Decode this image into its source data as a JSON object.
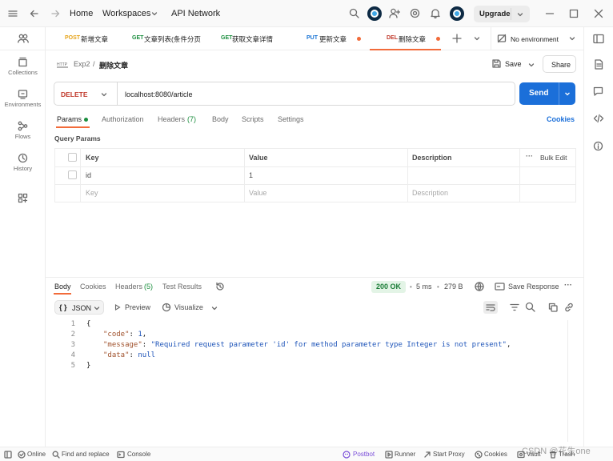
{
  "titlebar": {
    "home": "Home",
    "workspaces": "Workspaces",
    "api_network": "API Network",
    "upgrade": "Upgrade"
  },
  "tabs": [
    {
      "method": "POST",
      "name": "新增文章"
    },
    {
      "method": "GET",
      "name": "文章列表(条件分页"
    },
    {
      "method": "GET",
      "name": "获取文章详情"
    },
    {
      "method": "PUT",
      "name": "更新文章"
    },
    {
      "method": "DEL",
      "name": "删除文章"
    }
  ],
  "environment": "No environment",
  "sidebar": [
    {
      "label": "Collections"
    },
    {
      "label": "Environments"
    },
    {
      "label": "Flows"
    },
    {
      "label": "History"
    }
  ],
  "breadcrumb": {
    "parent": "Exp2",
    "separator": "/",
    "current": "删除文章"
  },
  "actions": {
    "save": "Save",
    "share": "Share"
  },
  "request": {
    "method": "DELETE",
    "url": "localhost:8080/article",
    "send": "Send"
  },
  "request_tabs": {
    "params": "Params",
    "authorization": "Authorization",
    "headers": "Headers",
    "headers_count": "(7)",
    "body": "Body",
    "scripts": "Scripts",
    "settings": "Settings",
    "cookies": "Cookies"
  },
  "query_params": {
    "title": "Query Params",
    "columns": [
      "Key",
      "Value",
      "Description"
    ],
    "bulk_edit": "Bulk Edit",
    "rows": [
      {
        "key": "id",
        "value": "1",
        "description": ""
      }
    ],
    "placeholder": {
      "key": "Key",
      "value": "Value",
      "description": "Description"
    }
  },
  "response_tabs": {
    "body": "Body",
    "cookies": "Cookies",
    "headers": "Headers",
    "headers_count": "(5)",
    "test_results": "Test Results"
  },
  "response_meta": {
    "status": "200 OK",
    "time": "5 ms",
    "size": "279 B",
    "save_response": "Save Response"
  },
  "response_view": {
    "format": "JSON",
    "preview": "Preview",
    "visualize": "Visualize"
  },
  "response_body": {
    "line_numbers": [
      "1",
      "2",
      "3",
      "4",
      "5"
    ],
    "open_brace": "{",
    "code_key": "\"code\"",
    "code_value": "1",
    "message_key": "\"message\"",
    "message_value": "\"Required request parameter 'id' for method parameter type Integer is not present\"",
    "data_key": "\"data\"",
    "data_value": "null",
    "close_brace": "}"
  },
  "statusbar": {
    "online": "Online",
    "find_replace": "Find and replace",
    "console": "Console",
    "postbot": "Postbot",
    "runner": "Runner",
    "start_proxy": "Start Proxy",
    "cookies": "Cookies",
    "vault": "Vault",
    "trash": "Trash",
    "watermark": "CSDN @花生one"
  },
  "colors": {
    "accent_orange": "#f26b3a",
    "send_blue": "#1b6fd9",
    "status_green": "#1b7d37",
    "delete_red": "#c0392b"
  }
}
